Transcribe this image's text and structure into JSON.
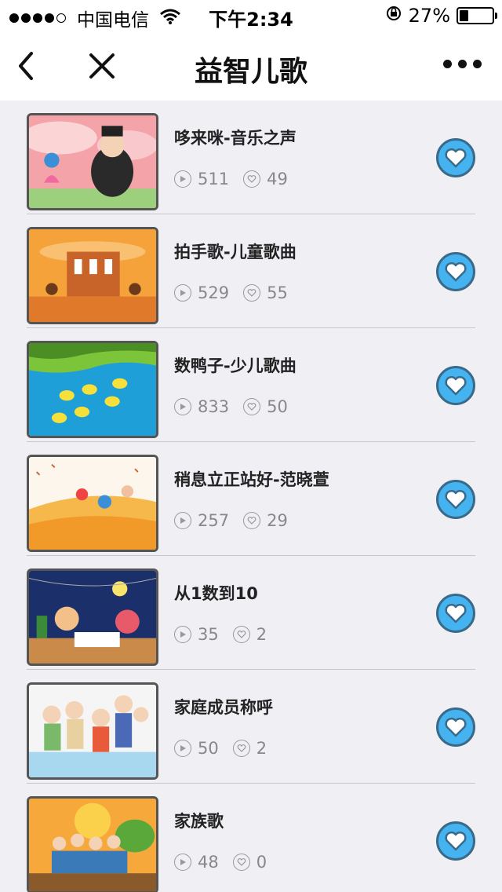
{
  "status_bar": {
    "carrier": "中国电信",
    "time": "下午2:34",
    "battery_percent": "27%",
    "battery_level": 0.27,
    "signal_bars": 4
  },
  "nav": {
    "title": "益智儿歌",
    "back_icon": "chevron-left-icon",
    "close_icon": "close-icon",
    "more_icon": "more-icon"
  },
  "colors": {
    "accent": "#45b3f0",
    "fav_border": "#3a6a8a",
    "background": "#efeff4"
  },
  "songs": [
    {
      "title": "哆来咪-音乐之声",
      "plays": "511",
      "likes": "49"
    },
    {
      "title": "拍手歌-儿童歌曲",
      "plays": "529",
      "likes": "55"
    },
    {
      "title": "数鸭子-少儿歌曲",
      "plays": "833",
      "likes": "50"
    },
    {
      "title": "稍息立正站好-范晓萱",
      "plays": "257",
      "likes": "29"
    },
    {
      "title": "从1数到10",
      "plays": "35",
      "likes": "2"
    },
    {
      "title": "家庭成员称呼",
      "plays": "50",
      "likes": "2"
    },
    {
      "title": "家族歌",
      "plays": "48",
      "likes": "0"
    }
  ]
}
